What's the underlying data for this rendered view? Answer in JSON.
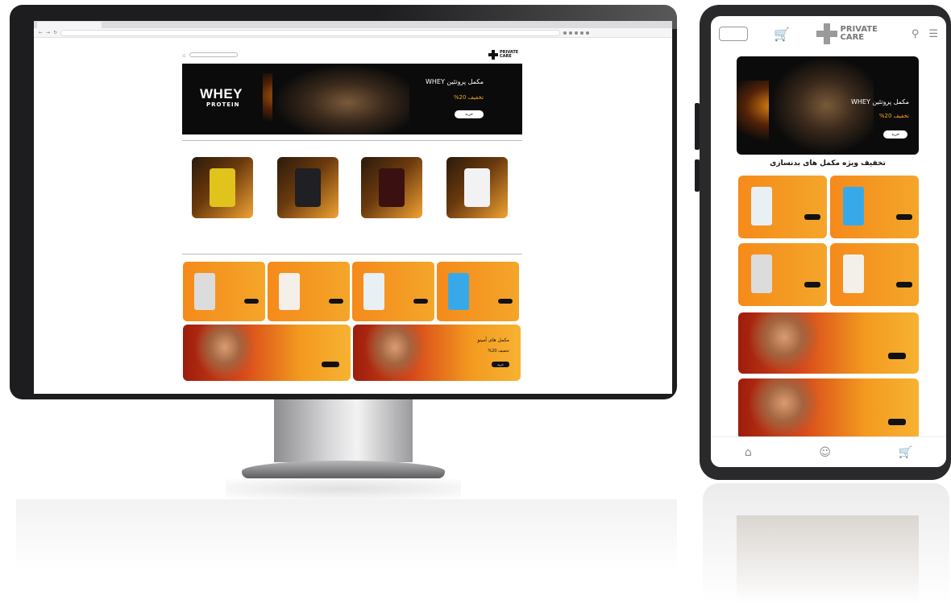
{
  "browser": {
    "tab_title": "",
    "url": "",
    "colors": {
      "chrome": "#dcdcdf"
    }
  },
  "desktop_site": {
    "logo_text": "PRIVATE CARE",
    "header_menu": "",
    "search_placeholder": "",
    "hero": {
      "brand": "WHEY",
      "brand_sub": "PROTEIN",
      "title": "مکمل پروتئین WHEY",
      "discount": "تخفیف 20%",
      "button": "خرید"
    },
    "section_products_title": "",
    "products": [
      {
        "name": "",
        "desc": "",
        "jar_color": "#f2f2f2"
      },
      {
        "name": "",
        "desc": "",
        "jar_color": "#3a1010"
      },
      {
        "name": "",
        "desc": "",
        "jar_color": "#1f1f24"
      },
      {
        "name": "",
        "desc": "",
        "jar_color": "#e0c41c"
      }
    ],
    "section_promo_title": "",
    "promos": [
      {
        "name": "",
        "off": "",
        "button": "",
        "jar_color": "#38a9e8"
      },
      {
        "name": "",
        "off": "",
        "button": "",
        "jar_color": "#e8f0f3"
      },
      {
        "name": "",
        "off": "",
        "button": "",
        "jar_color": "#f3f0ea"
      },
      {
        "name": "",
        "off": "",
        "button": "",
        "jar_color": "#dcdcdc"
      }
    ],
    "wide_banners": [
      {
        "title": "مکمل های آمینو",
        "off": "تخفیف 20%",
        "button": "خرید"
      },
      {
        "title": "",
        "off": "",
        "button": ""
      }
    ]
  },
  "tablet_site": {
    "login_label": "",
    "logo_text": "PRIVATE CARE",
    "hero": {
      "title": "مکمل پروتئین WHEY",
      "discount": "تخفیف 20%",
      "button": "خرید"
    },
    "section_title": "تخفیف ویژه مکمل های بدنسازی",
    "promos": [
      {
        "name": "",
        "off": "",
        "button": "",
        "jar_color": "#38a9e8"
      },
      {
        "name": "",
        "off": "",
        "button": "",
        "jar_color": "#e8f0f3"
      },
      {
        "name": "",
        "off": "",
        "button": "",
        "jar_color": "#f3f0ea"
      },
      {
        "name": "",
        "off": "",
        "button": "",
        "jar_color": "#dcdcdc"
      }
    ],
    "wide_banners": [
      {
        "title": "",
        "off": "",
        "button": ""
      },
      {
        "title": "",
        "off": "",
        "button": ""
      }
    ],
    "icons": {
      "cart": "cart-icon",
      "search": "search-icon",
      "menu": "menu-icon",
      "home": "home-icon",
      "user": "user-icon"
    }
  }
}
